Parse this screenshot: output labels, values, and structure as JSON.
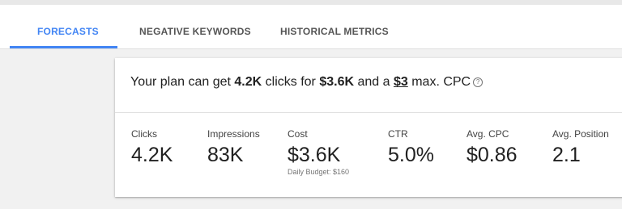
{
  "tabs": [
    {
      "label": "FORECASTS",
      "active": true
    },
    {
      "label": "NEGATIVE KEYWORDS",
      "active": false
    },
    {
      "label": "HISTORICAL METRICS",
      "active": false
    }
  ],
  "summary": {
    "prefix": "Your plan can get ",
    "clicks": "4.2K",
    "mid1": " clicks for ",
    "cost": "$3.6K",
    "mid2": " and a ",
    "max_cpc": "$3",
    "suffix": " max. CPC",
    "help_icon": "?"
  },
  "metrics": [
    {
      "label": "Clicks",
      "value": "4.2K"
    },
    {
      "label": "Impressions",
      "value": "83K"
    },
    {
      "label": "Cost",
      "value": "$3.6K",
      "sub": "Daily Budget: $160"
    },
    {
      "label": "CTR",
      "value": "5.0%"
    },
    {
      "label": "Avg. CPC",
      "value": "$0.86"
    },
    {
      "label": "Avg. Position",
      "value": "2.1"
    }
  ],
  "colors": {
    "accent": "#4285f4",
    "tab_inactive": "#555555",
    "text": "#212121",
    "background": "#f1f1f1"
  }
}
